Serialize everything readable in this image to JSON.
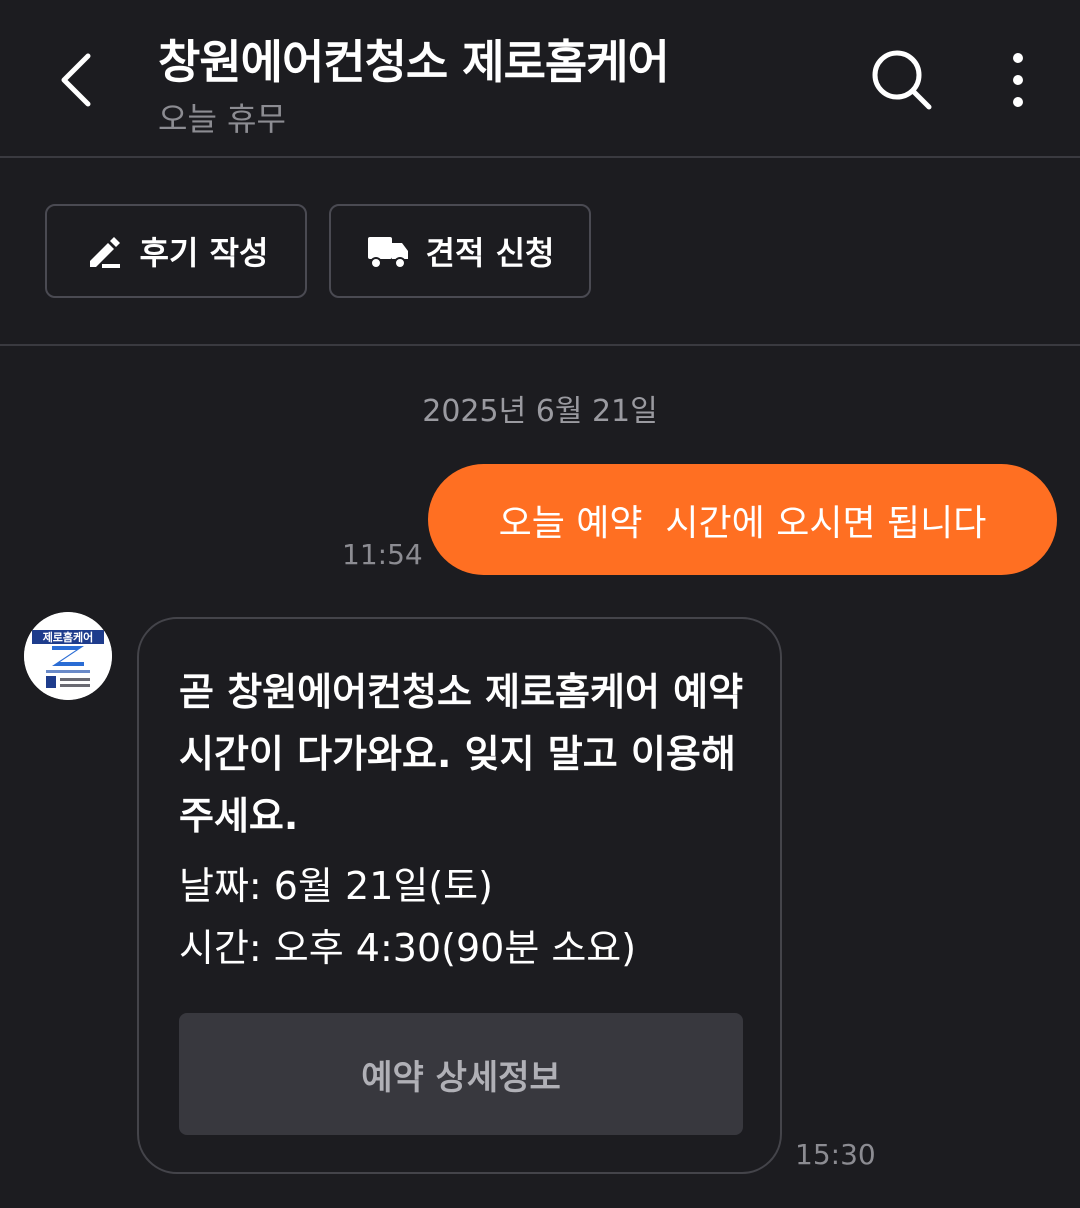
{
  "header": {
    "title": "창원에어컨청소 제로홈케어",
    "subtitle": "오늘 휴무",
    "back_icon": "chevron-left-icon",
    "search_icon": "search-icon",
    "more_icon": "more-vertical-icon"
  },
  "actions": {
    "review_label": "후기 작성",
    "review_icon": "pencil-icon",
    "quote_label": "견적 신청",
    "quote_icon": "truck-icon"
  },
  "chat": {
    "date_separator": "2025년 6월 21일",
    "outgoing": {
      "text": "오늘 예약  시간에 오시면 됩니다",
      "time": "11:54"
    },
    "incoming": {
      "avatar_text": "제로홈케어",
      "headline": "곧 창원에어컨청소 제로홈케어 예약 시간이 다가와요. 잊지 말고 이용해주세요.",
      "date_line": "날짜: 6월 21일(토)",
      "time_line": "시간: 오후 4:30(90분 소요)",
      "detail_button": "예약 상세정보",
      "time": "15:30"
    }
  },
  "colors": {
    "background": "#1c1c20",
    "accent": "#ff6f22",
    "muted_text": "#8c8c92"
  }
}
